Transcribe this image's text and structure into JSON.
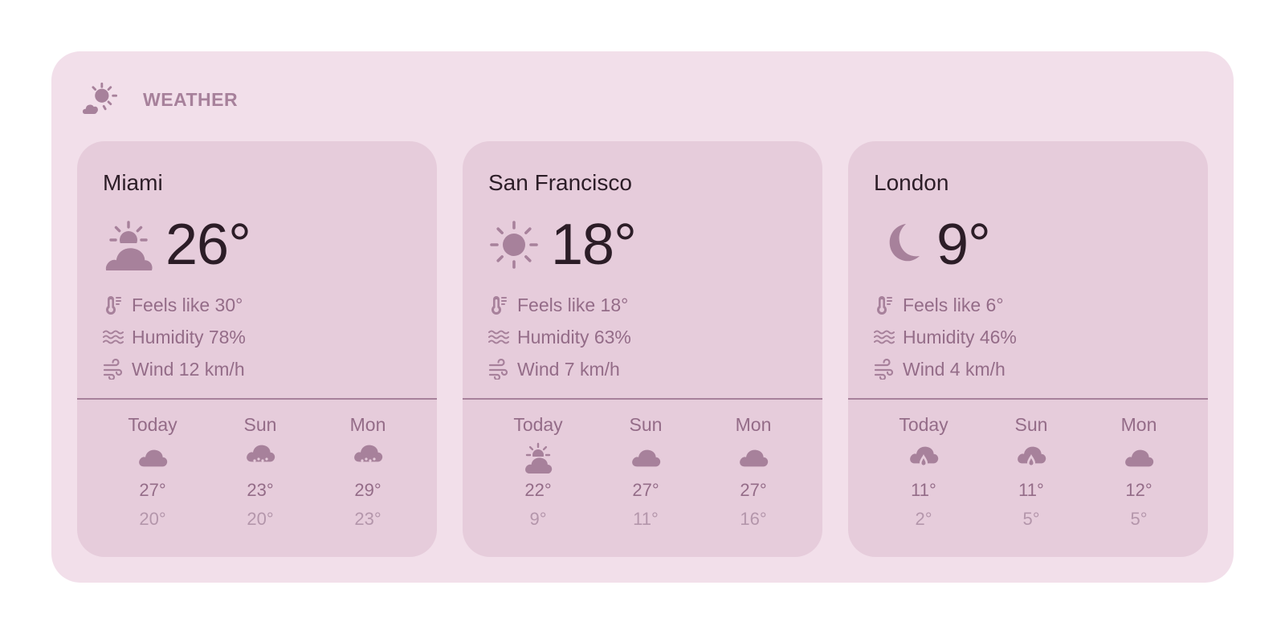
{
  "widget": {
    "title": "WEATHER",
    "icon": "partly-cloudy-icon",
    "accent_color": "#a7819b"
  },
  "cities": [
    {
      "name": "Miami",
      "current_temp": "26°",
      "current_icon": "sun-cloud-icon",
      "feels_like": "Feels like 30°",
      "humidity": "Humidity 78%",
      "wind": "Wind 12 km/h",
      "forecast": [
        {
          "day": "Today",
          "icon": "cloud-icon",
          "high": "27°",
          "low": "20°"
        },
        {
          "day": "Sun",
          "icon": "rain-cloud-icon",
          "high": "23°",
          "low": "20°"
        },
        {
          "day": "Mon",
          "icon": "rain-cloud-icon",
          "high": "29°",
          "low": "23°"
        }
      ]
    },
    {
      "name": "San Francisco",
      "current_temp": "18°",
      "current_icon": "sun-icon",
      "feels_like": "Feels like 18°",
      "humidity": "Humidity 63%",
      "wind": "Wind 7 km/h",
      "forecast": [
        {
          "day": "Today",
          "icon": "sun-cloud-icon",
          "high": "22°",
          "low": "9°"
        },
        {
          "day": "Sun",
          "icon": "cloud-icon",
          "high": "27°",
          "low": "11°"
        },
        {
          "day": "Mon",
          "icon": "cloud-icon",
          "high": "27°",
          "low": "16°"
        }
      ]
    },
    {
      "name": "London",
      "current_temp": "9°",
      "current_icon": "moon-icon",
      "feels_like": "Feels like 6°",
      "humidity": "Humidity 46%",
      "wind": "Wind 4 km/h",
      "forecast": [
        {
          "day": "Today",
          "icon": "drizzle-cloud-icon",
          "high": "11°",
          "low": "2°"
        },
        {
          "day": "Sun",
          "icon": "drizzle-cloud-icon",
          "high": "11°",
          "low": "5°"
        },
        {
          "day": "Mon",
          "icon": "cloud-icon",
          "high": "12°",
          "low": "5°"
        }
      ]
    }
  ]
}
